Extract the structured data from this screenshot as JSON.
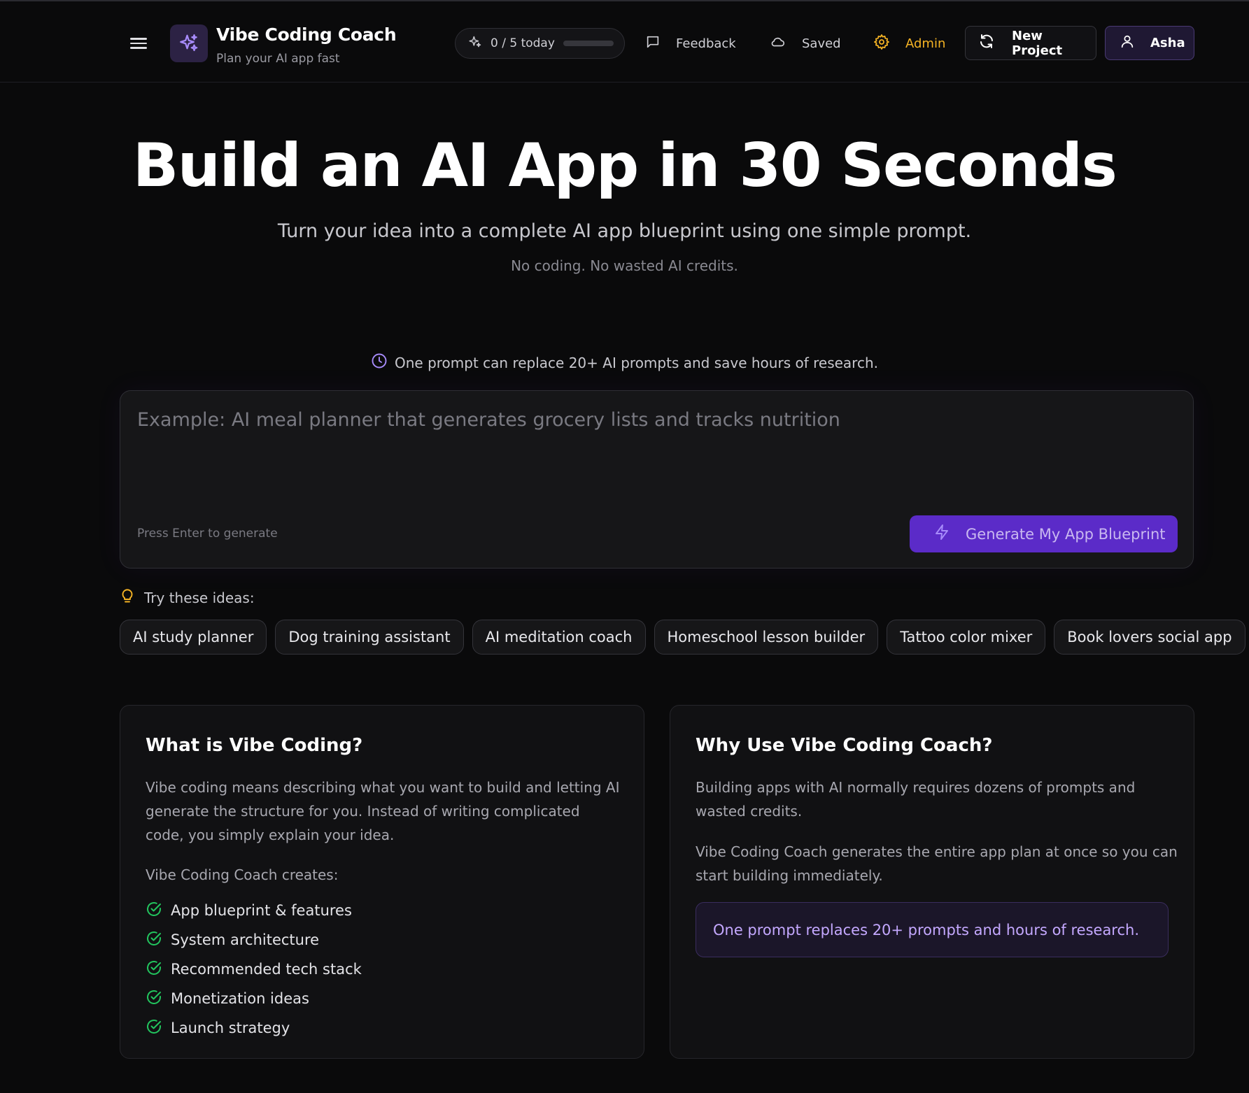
{
  "header": {
    "brand_title": "Vibe Coding Coach",
    "brand_subtitle": "Plan your AI app fast",
    "usage": {
      "text": "0 / 5 today",
      "used": 0,
      "limit": 5
    },
    "feedback_label": "Feedback",
    "saved_label": "Saved",
    "admin_label": "Admin",
    "new_project_label": "New Project",
    "user_name": "Asha"
  },
  "hero": {
    "title": "Build an AI App in 30 Seconds",
    "subtitle": "Turn your idea into a complete AI app blueprint using one simple prompt.",
    "note": "No coding. No wasted AI credits.",
    "tip": "One prompt can replace 20+ AI prompts and save hours of research."
  },
  "prompt": {
    "placeholder": "Example: AI meal planner that generates grocery lists and tracks nutrition",
    "value": "",
    "hint": "Press Enter to generate",
    "generate_label": "Generate My App Blueprint"
  },
  "ideas": {
    "label": "Try these ideas:",
    "items": [
      "AI study planner",
      "Dog training assistant",
      "AI meditation coach",
      "Homeschool lesson builder",
      "Tattoo color mixer",
      "Book lovers social app"
    ]
  },
  "cards": {
    "what": {
      "title": "What is Vibe Coding?",
      "body": "Vibe coding means describing what you want to build and letting AI generate the structure for you. Instead of writing complicated code, you simply explain your idea.",
      "creates_label": "Vibe Coding Coach creates:",
      "items": [
        "App blueprint & features",
        "System architecture",
        "Recommended tech stack",
        "Monetization ideas",
        "Launch strategy"
      ]
    },
    "why": {
      "title": "Why Use Vibe Coding Coach?",
      "body1": "Building apps with AI normally requires dozens of prompts and wasted credits.",
      "body2": "Vibe Coding Coach generates the entire app plan at once so you can start building immediately.",
      "callout": "One prompt replaces 20+ prompts and hours of research."
    }
  },
  "colors": {
    "background": "#0a0a0b",
    "accent": "#7c3aed",
    "button_primary": "#5b2bc8",
    "admin": "#f5b324",
    "check": "#22c55e",
    "callout_text": "#c4a8ff"
  },
  "icons": {
    "menu": "hamburger-menu-icon",
    "logo": "sparkles-icon",
    "usage": "sparkles-icon",
    "feedback": "message-square-icon",
    "saved": "cloud-icon",
    "admin": "gear-icon",
    "new_project": "refresh-icon",
    "user": "user-icon",
    "tip": "clock-icon",
    "generate": "lightning-icon",
    "ideas": "lightbulb-icon",
    "check": "check-circle-icon"
  }
}
